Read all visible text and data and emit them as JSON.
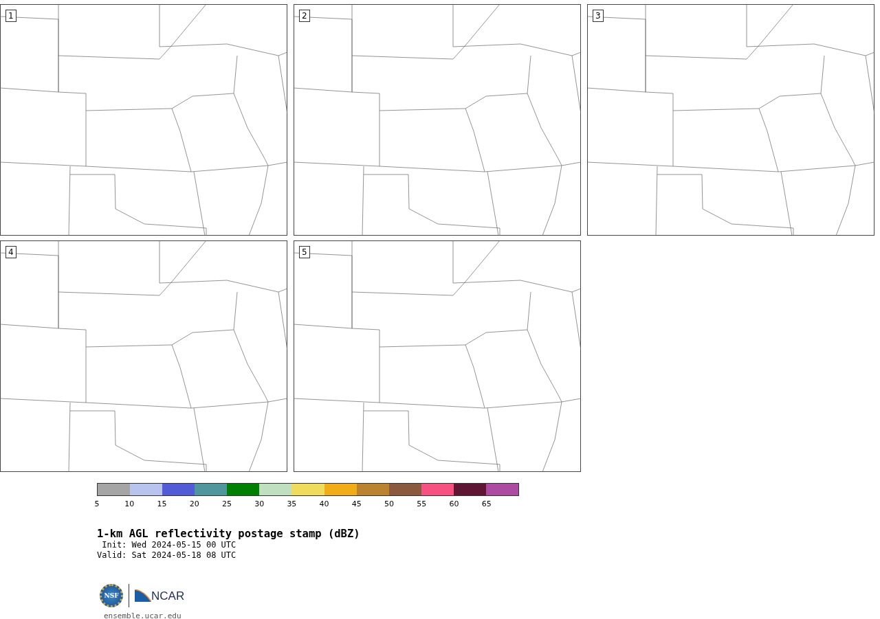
{
  "panels": [
    {
      "label": "1"
    },
    {
      "label": "2"
    },
    {
      "label": "3"
    },
    {
      "label": "4"
    },
    {
      "label": "5"
    }
  ],
  "colorbar": {
    "segments": [
      {
        "color": "#a5a5a5"
      },
      {
        "color": "#b8c3ee"
      },
      {
        "color": "#525cd6"
      },
      {
        "color": "#4f979c"
      },
      {
        "color": "#008000"
      },
      {
        "color": "#bfdfbf"
      },
      {
        "color": "#f0dc5c"
      },
      {
        "color": "#f0ad18"
      },
      {
        "color": "#bb832f"
      },
      {
        "color": "#8b5a3e"
      },
      {
        "color": "#f55181"
      },
      {
        "color": "#5e1634"
      },
      {
        "color": "#ad4aa2"
      }
    ],
    "ticks": [
      "5",
      "10",
      "15",
      "20",
      "25",
      "30",
      "35",
      "40",
      "45",
      "50",
      "55",
      "60",
      "65"
    ]
  },
  "title": "1-km AGL reflectivity postage stamp (dBZ)",
  "init": " Init: Wed 2024-05-15 00 UTC",
  "valid": "Valid: Sat 2024-05-18 08 UTC",
  "logos": {
    "nsf": "NSF",
    "ncar": "NCAR"
  },
  "site": "ensemble.ucar.edu"
}
